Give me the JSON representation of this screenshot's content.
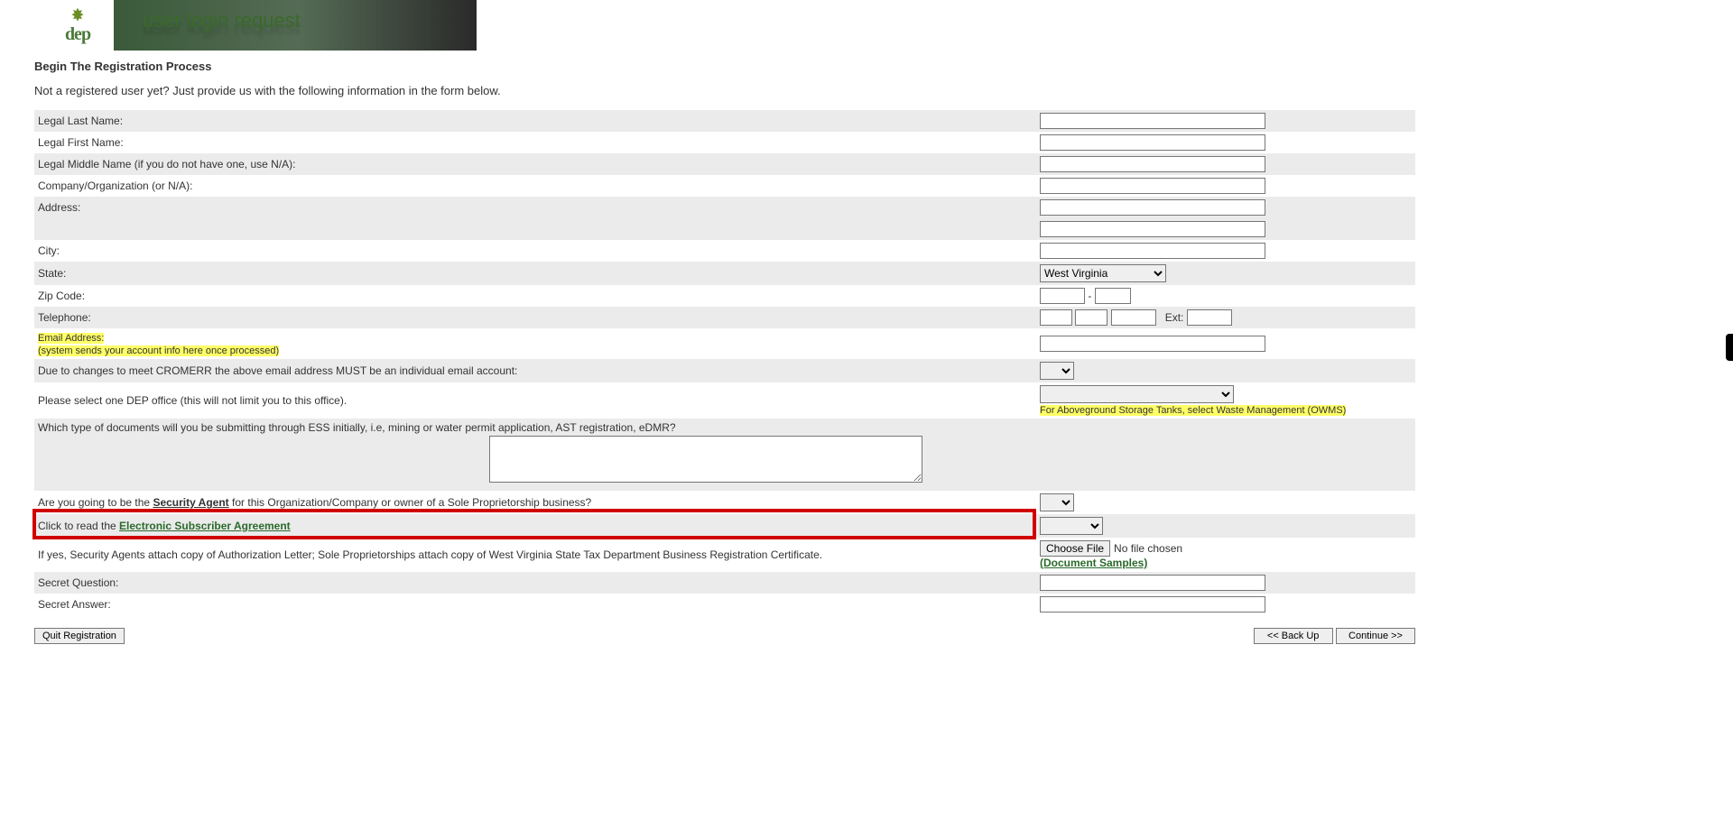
{
  "banner": {
    "logo_text": "dep",
    "title": "user login request"
  },
  "heading": "Begin The Registration Process",
  "subtext": "Not a registered user yet? Just provide us with the following information in the form below.",
  "labels": {
    "last_name": "Legal Last Name:",
    "first_name": "Legal First Name:",
    "middle_name": "Legal Middle Name (if you do not have one, use N/A):",
    "company": "Company/Organization (or N/A):",
    "address": "Address:",
    "city": "City:",
    "state": "State:",
    "zip": "Zip Code:",
    "telephone": "Telephone:",
    "tel_ext": "Ext:",
    "email": "Email Address:",
    "email_note": "(system sends your account info here once processed)",
    "cromerr": "Due to changes to meet CROMERR the above email address MUST be an individual email account:",
    "dep_office": "Please select one DEP office (this will not limit you to this office).",
    "dep_office_note": "For Aboveground Storage Tanks, select Waste Management (OWMS)",
    "doc_types": "Which type of documents will you be submitting through ESS initially, i.e, mining or water permit application, AST registration, eDMR?",
    "security_agent_q_pre": "Are you going to be the ",
    "security_agent_bold": "Security Agent",
    "security_agent_q_post": " for this Organization/Company or owner of a Sole Proprietorship business?",
    "esa_pre": "Click to read the ",
    "esa_link": "Electronic Subscriber Agreement",
    "attach_note": "If yes, Security Agents attach copy of Authorization Letter; Sole Proprietorships attach copy of West Virginia State Tax Department Business Registration Certificate.",
    "doc_samples": "(Document Samples)",
    "secret_q": "Secret Question:",
    "secret_a": "Secret Answer:",
    "choose_file": "Choose File",
    "no_file": "No file chosen"
  },
  "state_value": "West Virginia",
  "buttons": {
    "quit": "Quit Registration",
    "back": "<<  Back Up",
    "continue": "Continue >>"
  }
}
